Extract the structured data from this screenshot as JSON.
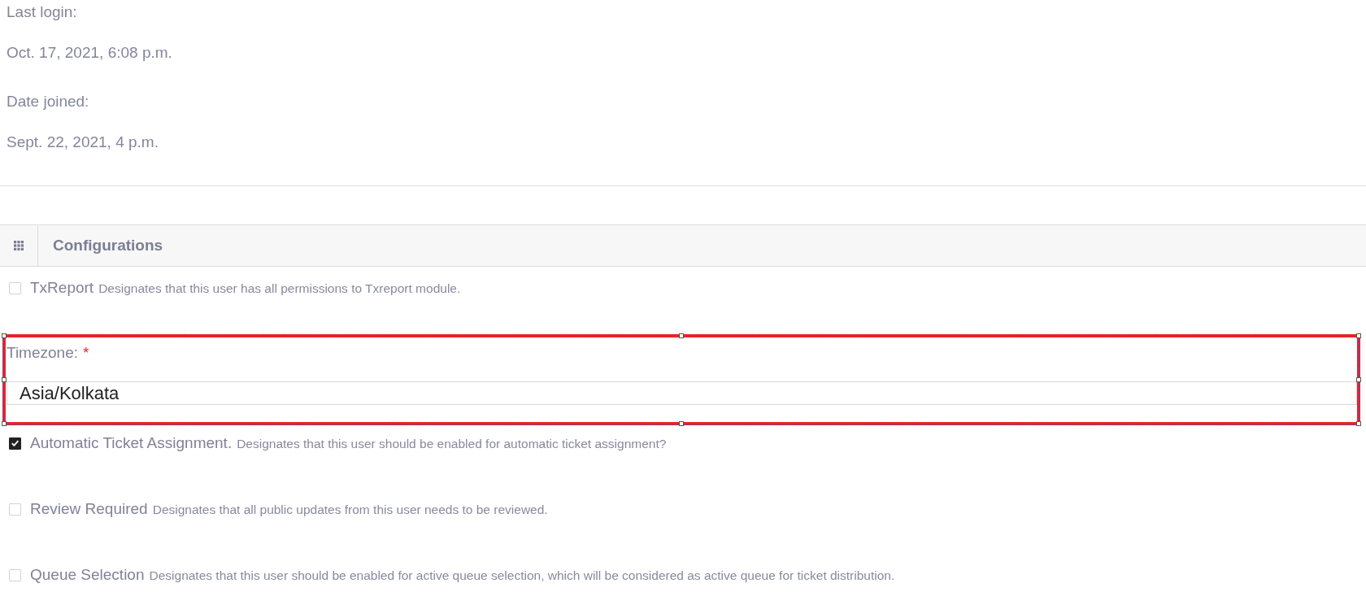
{
  "account_info": [
    {
      "label": "Last login:",
      "value": "Oct. 17, 2021, 6:08 p.m."
    },
    {
      "label": "Date joined:",
      "value": "Sept. 22, 2021, 4 p.m."
    }
  ],
  "configurations": {
    "title": "Configurations",
    "fields": [
      {
        "kind": "checkbox",
        "label": "TxReport",
        "description": "Designates that this user has all permissions to Txreport module.",
        "checked": false
      },
      {
        "kind": "text_input",
        "label": "Timezone:",
        "required_mark": "*",
        "value": "Asia/Kolkata",
        "highlighted": true
      },
      {
        "kind": "checkbox",
        "label": "Automatic Ticket Assignment.",
        "description": "Designates that this user should be enabled for automatic ticket assignment?",
        "checked": true
      },
      {
        "kind": "checkbox",
        "label": "Review Required",
        "description": "Designates that all public updates from this user needs to be reviewed.",
        "checked": false
      },
      {
        "kind": "checkbox",
        "label": "Queue Selection",
        "description": "Designates that this user should be enabled for active queue selection, which will be considered as active queue for ticket distribution.",
        "checked": false
      }
    ]
  }
}
